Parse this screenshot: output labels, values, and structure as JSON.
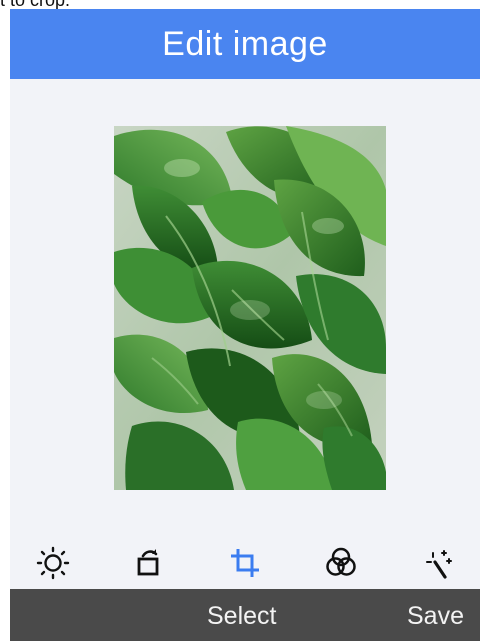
{
  "caption": {
    "text": "t to crop."
  },
  "header": {
    "title": "Edit image"
  },
  "image": {
    "description_icon": "plant-photo"
  },
  "toolbar": {
    "items": [
      {
        "icon": "brightness-icon",
        "active": false
      },
      {
        "icon": "rotate-icon",
        "active": false
      },
      {
        "icon": "crop-icon",
        "active": true
      },
      {
        "icon": "filter-icon",
        "active": false
      },
      {
        "icon": "magic-wand-icon",
        "active": false
      }
    ]
  },
  "bottom_bar": {
    "select_label": "Select",
    "save_label": "Save"
  },
  "colors": {
    "header_bg": "#4a85f0",
    "content_bg": "#f2f3f8",
    "active_tool": "#3b7cf0",
    "bottom_bar_bg": "#4a4a4a"
  }
}
